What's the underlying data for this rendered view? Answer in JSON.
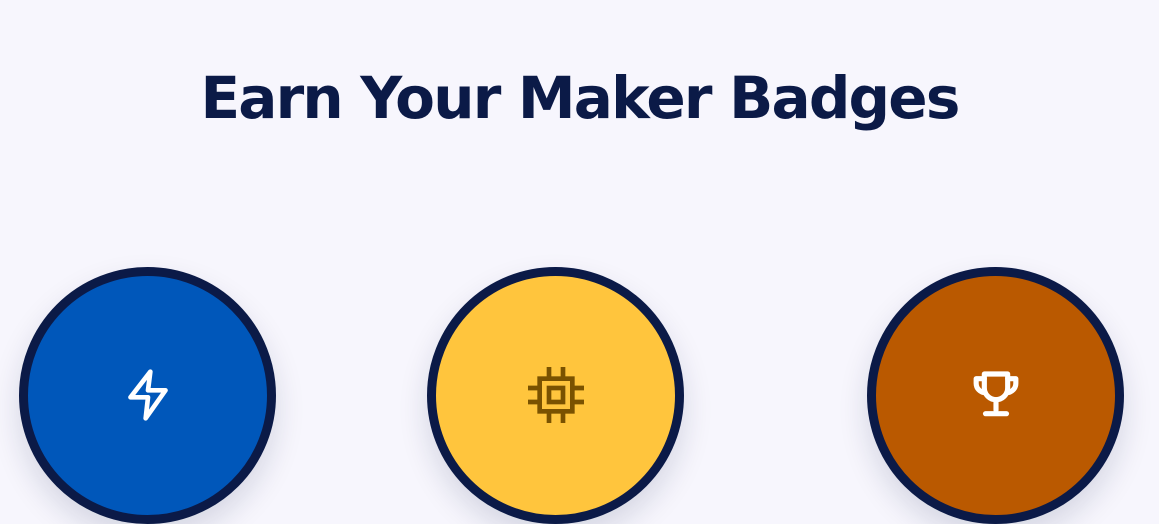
{
  "section": {
    "title": "Earn Your Maker Badges"
  },
  "badges": [
    {
      "icon": "lightning-icon",
      "color": "#0057BA",
      "icon_color": "#FFFFFF"
    },
    {
      "icon": "chip-icon",
      "color": "#FFC53D",
      "icon_color": "#7A5200"
    },
    {
      "icon": "trophy-icon",
      "color": "#BA5900",
      "icon_color": "#FFFFFF"
    }
  ],
  "colors": {
    "background": "#F7F6FD",
    "heading": "#0B1A47",
    "badge_border": "#0B1A47"
  }
}
